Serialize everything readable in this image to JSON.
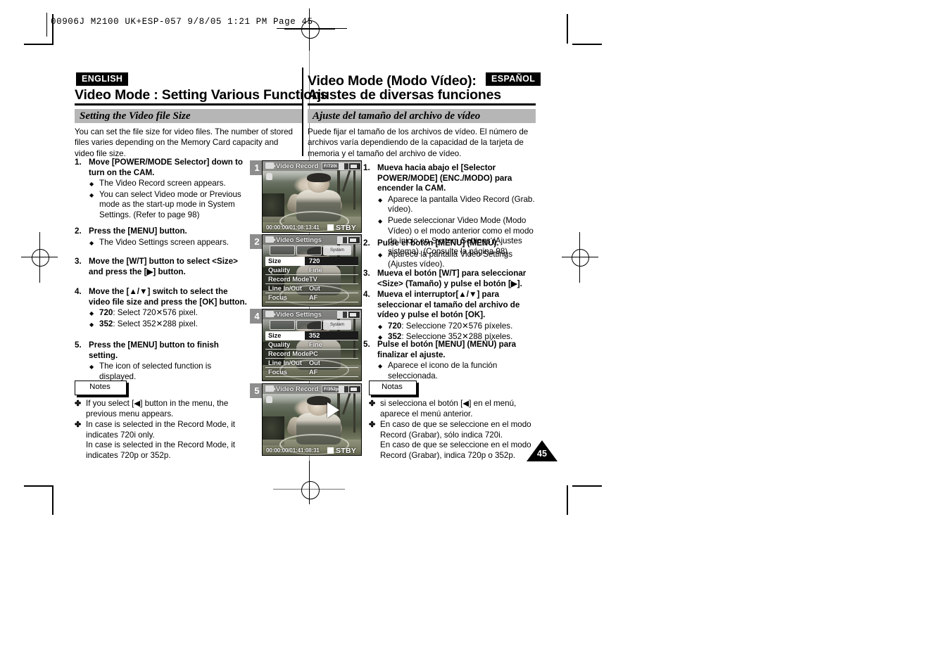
{
  "file_header": {
    "text": "00906J M2100 UK+ESP-057   9/8/05 1:21 PM   Page 45"
  },
  "english": {
    "lang_chip": "ENGLISH",
    "title": "Video Mode : Setting Various Functions",
    "section_banner": "Setting the Video file Size",
    "intro": "You can set the file size for video files. The number of stored files varies depending on the Memory Card capacity and video file size.",
    "steps": [
      {
        "num": "1.",
        "head": "Move [POWER/MODE Selector] down to turn on the CAM.",
        "bullets": [
          "The Video Record screen appears.",
          "You can select Video mode or Previous mode as the start-up mode in System Settings. (Refer to page 98)"
        ]
      },
      {
        "num": "2.",
        "head": "Press the [MENU] button.",
        "bullets": [
          "The Video Settings screen appears."
        ]
      },
      {
        "num": "3.",
        "head": "Move the [W/T] button to select <Size> and press the [▶] button.",
        "bullets": []
      },
      {
        "num": "4.",
        "head": "Move the [▲/▼] switch to select the video file size and press the [OK] button.",
        "bullets": [
          "<b>720</b>: Select 720✕576 pixel.",
          "<b>352</b>: Select 352✕288 pixel."
        ]
      },
      {
        "num": "5.",
        "head": "Press the [MENU] button to finish setting.",
        "bullets": [
          "The icon of selected function is displayed."
        ]
      }
    ],
    "notes_label": "Notes",
    "notes": [
      "If you select [◀] button in the menu, the previous menu appears.",
      "In case <TV> is selected in the Record Mode, it indicates 720i only.<br>In case <PC> is selected in the Record Mode, it indicates 720p or 352p."
    ]
  },
  "spanish": {
    "lang_chip": "ESPAÑOL",
    "title_line1": "Video Mode (Modo Vídeo):",
    "title_line2": "Ajustes de diversas funciones",
    "section_banner": "Ajuste del tamaño del archivo de vídeo",
    "intro": "Puede fijar el tamaño de los archivos de vídeo. El número de archivos varía dependiendo de la capacidad de la tarjeta de memoria y el tamaño del archivo de vídeo.",
    "steps": [
      {
        "num": "1.",
        "head": "Mueva hacia abajo el [Selector POWER/MODE] (ENC./MODO) para encender la CAM.",
        "bullets": [
          "Aparece la pantalla Video Record (Grab. vídeo).",
          "Puede seleccionar Video Mode (Modo Vídeo) o el modo anterior como el modo de inicio en System Settings (Ajustes sistema). (Consulte la página 98)"
        ]
      },
      {
        "num": "2.",
        "head": "Pulse el botón [MENU] (MENÚ).",
        "bullets": [
          "Aparece la pantalla Video Settings (Ajustes vídeo)."
        ]
      },
      {
        "num": "3.",
        "head": "Mueva el botón [W/T] para seleccionar <Size> (Tamaño) y pulse el botón [▶].",
        "bullets": []
      },
      {
        "num": "4.",
        "head": "Mueva el interruptor[▲/▼] para seleccionar el tamaño del archivo de vídeo y pulse el botón [OK].",
        "bullets": [
          "<b>720</b>: Seleccione 720✕576 píxeles.",
          "<b>352</b>: Seleccione 352✕288 píxeles."
        ]
      },
      {
        "num": "5.",
        "head": "Pulse el botón [MENU] (MENÚ) para finalizar el ajuste.",
        "bullets": [
          "Aparece el icono de la función seleccionada."
        ]
      }
    ],
    "notes_label": "Notas",
    "notes": [
      "si selecciona el botón [◀] en el menú, aparece el menú anterior.",
      "En caso de que se seleccione <TV> en el modo Record (Grabar), sólo indica 720i.<br>En caso de que se seleccione <PC> en el modo Record (Grabar), indica 720p o 352p."
    ]
  },
  "screens": [
    {
      "badge": "1",
      "kind": "record",
      "osd_title": "Video Record",
      "res_badge": "F/720i",
      "timecode": "00:00:00/01:08:13:41",
      "status": "STBY",
      "show_play": false
    },
    {
      "badge": "2",
      "kind": "settings",
      "osd_title": "Video Settings",
      "tab_label": "System",
      "rows": [
        {
          "label": "Size",
          "value": "720",
          "selected": true
        },
        {
          "label": "Quality",
          "value": "Fine",
          "selected": false
        },
        {
          "label": "Record Mode",
          "value": "TV",
          "selected": false
        },
        {
          "label": "Line In/Out",
          "value": "Out",
          "selected": false
        },
        {
          "label": "Focus",
          "value": "AF",
          "selected": false
        }
      ]
    },
    {
      "badge": "4",
      "kind": "settings",
      "osd_title": "Video Settings",
      "tab_label": "System",
      "rows": [
        {
          "label": "Size",
          "value": "352",
          "selected": true
        },
        {
          "label": "Quality",
          "value": "Fine",
          "selected": false
        },
        {
          "label": "Record Mode",
          "value": "PC",
          "selected": false
        },
        {
          "label": "Line In/Out",
          "value": "Out",
          "selected": false
        },
        {
          "label": "Focus",
          "value": "AF",
          "selected": false
        }
      ]
    },
    {
      "badge": "5",
      "kind": "record",
      "osd_title": "Video Record",
      "res_badge": "F/352p",
      "timecode": "00:00:00/01:41:08:31",
      "status": "STBY",
      "show_play": true
    }
  ],
  "page_number": "45",
  "colors": {
    "banner_gray": "#b6b6b6",
    "badge_gray": "#8d8d8d",
    "chip_black": "#000000"
  }
}
